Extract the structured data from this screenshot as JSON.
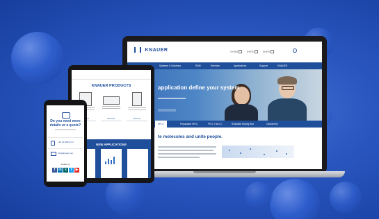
{
  "colors": {
    "background": "#2a57c0",
    "brand_blue": "#1f4f9b",
    "facebook": "#3b5998",
    "linkedin": "#0077b5",
    "twitter": "#1da1f2",
    "youtube": "#e52d27",
    "xing": "#026466"
  },
  "laptop": {
    "logo": "KNAUER",
    "utility": [
      "Contact",
      "Events",
      "Search"
    ],
    "nav": [
      "Systems & Solutions",
      "RDM",
      "Services",
      "Applications",
      "Support",
      "KNAUER"
    ],
    "hero_title": "application define your system",
    "tabs": [
      "HPLC",
      "Preparative HPLC",
      "FPLC / Bio LC",
      "Simulated Moving Bed",
      "Osmometry"
    ],
    "body_title": "te molecules and unite people."
  },
  "tablet": {
    "title": "KNAUER PRODUCTS",
    "apps_title": "NEW APPLICATIONS",
    "product_button": "Discover"
  },
  "phone": {
    "question": "Do you need more details or a quote?",
    "phone_label": "+49 30 809727-0",
    "email_label": "info@knauer.net",
    "follow_label": "Follow us",
    "social_icons": [
      "facebook-icon",
      "linkedin-icon",
      "xing-icon",
      "twitter-icon",
      "youtube-icon"
    ]
  }
}
